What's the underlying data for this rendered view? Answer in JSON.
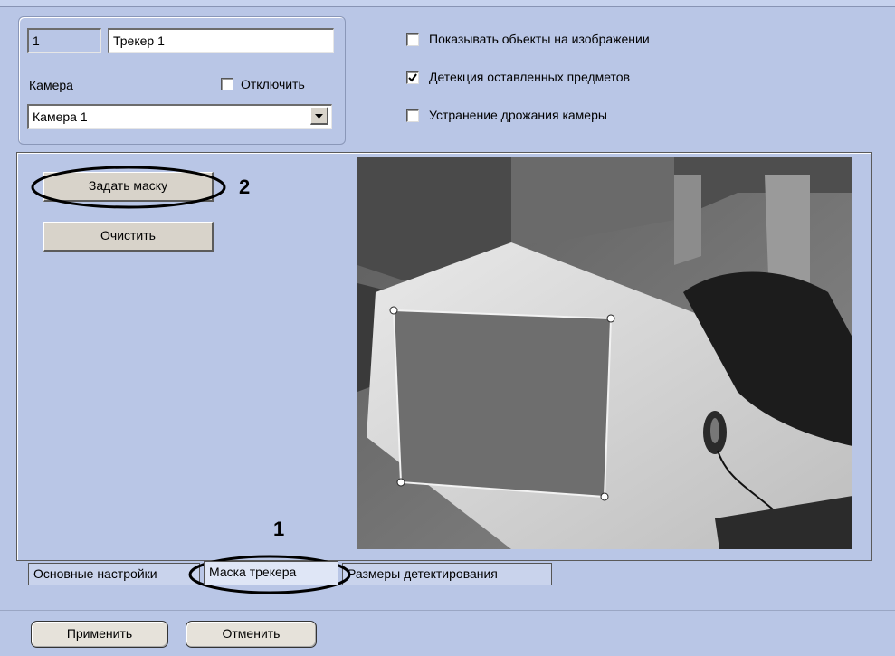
{
  "header": {
    "id_value": "1",
    "name_value": "Трекер 1",
    "camera_label": "Камера",
    "disable_label": "Отключить",
    "disable_checked": false,
    "camera_select_value": "Камера 1"
  },
  "options": [
    {
      "label": "Показывать обьекты на изображении",
      "checked": false
    },
    {
      "label": "Детекция оставленных предметов",
      "checked": true
    },
    {
      "label": "Устранение дрожания камеры",
      "checked": false
    }
  ],
  "mask_panel": {
    "set_mask_label": "Задать маску",
    "clear_label": "Очистить"
  },
  "tabs": [
    {
      "label": "Основные настройки",
      "active": false
    },
    {
      "label": "Маска трекера",
      "active": true
    },
    {
      "label": "Размеры детектирования",
      "active": false
    }
  ],
  "callouts": {
    "callout_1": "1",
    "callout_2": "2"
  },
  "footer": {
    "apply_label": "Применить",
    "cancel_label": "Отменить"
  },
  "colors": {
    "window_bg": "#b9c6e6",
    "mask_fill": "#6e6e6e"
  },
  "icons": {
    "checkbox_check": "check-icon",
    "dropdown_arrow": "chevron-down-icon"
  }
}
